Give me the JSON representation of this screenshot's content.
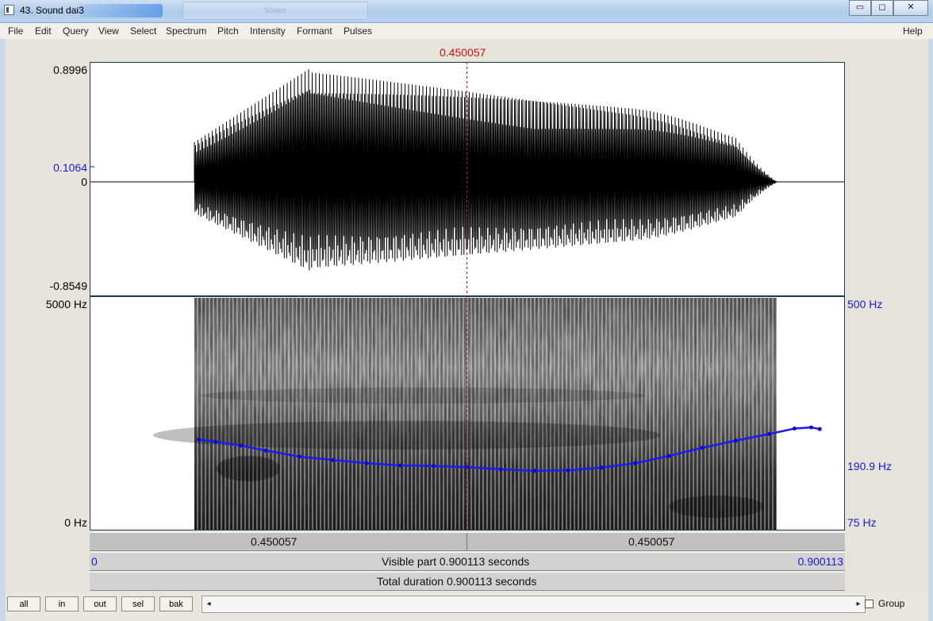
{
  "window": {
    "title": "43. Sound dai3",
    "ghost_title": "Scales",
    "buttons": {
      "minimize": "▭",
      "maximize": "◻",
      "close": "✕"
    }
  },
  "menu": {
    "items": [
      "File",
      "Edit",
      "Query",
      "View",
      "Select",
      "Spectrum",
      "Pitch",
      "Intensity",
      "Formant",
      "Pulses"
    ],
    "help": "Help"
  },
  "cursor": {
    "time_label": "0.450057",
    "time": 0.450057
  },
  "waveform": {
    "y_max": "0.8996",
    "y_cursor": "0.1064",
    "y_zero": "0",
    "y_min": "-0.8549"
  },
  "spectrogram": {
    "f_max": "5000 Hz",
    "f_min": "0 Hz",
    "pitch_max": "500 Hz",
    "pitch_cursor": "190.9 Hz",
    "pitch_min": "75 Hz"
  },
  "timebars": {
    "left_segment": "0.450057",
    "right_segment": "0.450057",
    "visible_start": "0",
    "visible_label": "Visible part 0.900113 seconds",
    "visible_end": "0.900113",
    "total_label": "Total duration 0.900113 seconds"
  },
  "bottom": {
    "buttons": [
      "all",
      "in",
      "out",
      "sel",
      "bak"
    ],
    "scroll_left": "◂",
    "scroll_right": "▸",
    "group_label": "Group"
  },
  "colors": {
    "cursor": "#d01010",
    "pitch": "#1a1aff",
    "axis_blue": "#1a1ad0"
  },
  "chart_data": {
    "type": "line",
    "title": "",
    "xlabel": "",
    "ylabel": "",
    "xlim": [
      0,
      0.900113
    ],
    "ylim": [
      75,
      500
    ],
    "series": [
      {
        "x": [
          0.13,
          0.15,
          0.18,
          0.21,
          0.25,
          0.29,
          0.33,
          0.37,
          0.41,
          0.45,
          0.49,
          0.53,
          0.57,
          0.61,
          0.65,
          0.69,
          0.73,
          0.77,
          0.81,
          0.84,
          0.86,
          0.87
        ],
        "values": [
          240,
          236,
          229,
          220,
          209,
          203,
          197,
          193,
          192,
          190,
          186,
          183,
          184,
          189,
          197,
          210,
          225,
          238,
          250,
          260,
          262,
          259
        ]
      }
    ]
  }
}
